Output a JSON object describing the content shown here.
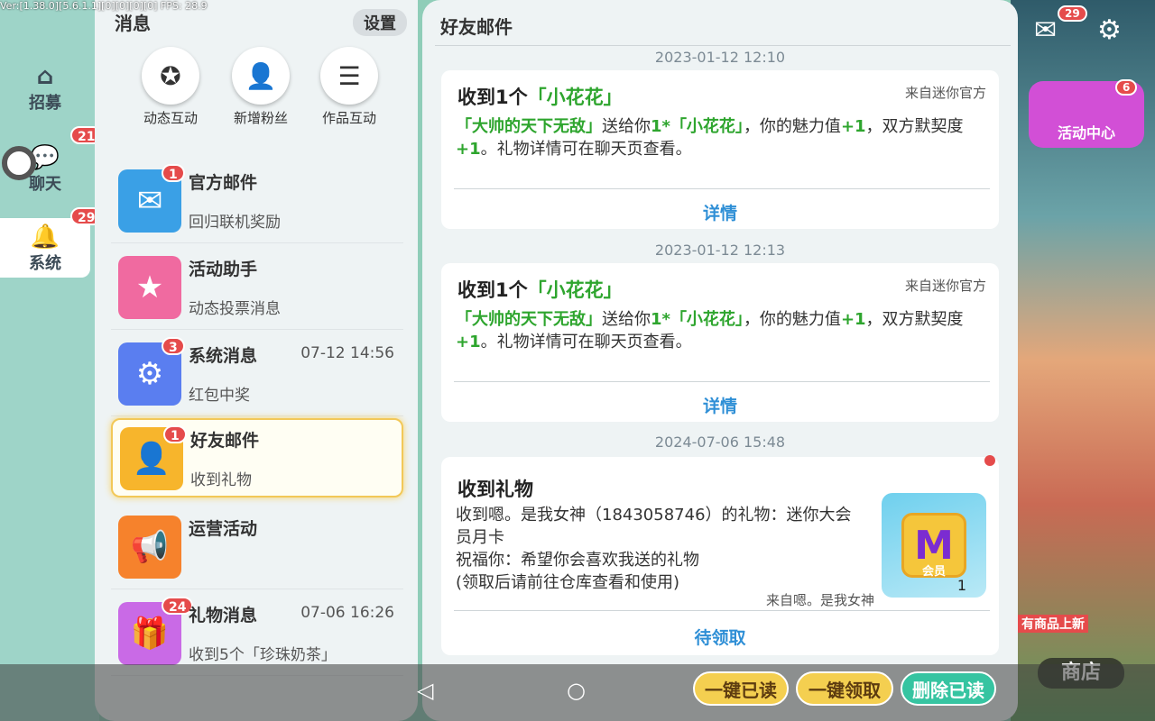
{
  "version_text": "Ver:[1.38.0][5.6.1.1][0][0][0][0] FPS: 28.9",
  "left_tabs": [
    {
      "label": "招募",
      "icon": "home-icon"
    },
    {
      "label": "聊天",
      "icon": "chat-icon",
      "badge": "21"
    },
    {
      "label": "系统",
      "icon": "bell-icon",
      "badge": "29"
    }
  ],
  "list": {
    "title": "消息",
    "settings": "设置",
    "quick": [
      {
        "label": "动态互动",
        "icon": "star-bubble-icon"
      },
      {
        "label": "新增粉丝",
        "icon": "new-fan-icon"
      },
      {
        "label": "作品互动",
        "icon": "list-icon"
      }
    ],
    "items": [
      {
        "name": "官方邮件",
        "sub": "回归联机奖励",
        "badge": "1",
        "time": "",
        "color": "#3aa0e6"
      },
      {
        "name": "活动助手",
        "sub": "动态投票消息",
        "badge": "",
        "time": "",
        "color": "#f06aa0"
      },
      {
        "name": "系统消息",
        "sub": "红包中奖",
        "badge": "3",
        "time": "07-12 14:56",
        "color": "#5a7ef0"
      },
      {
        "name": "好友邮件",
        "sub": "收到礼物",
        "badge": "1",
        "time": "",
        "color": "#f7b52c"
      },
      {
        "name": "运营活动",
        "sub": "",
        "badge": "",
        "time": "",
        "color": "#f6822c"
      },
      {
        "name": "礼物消息",
        "sub": "收到5个「珍珠奶茶」",
        "badge": "24",
        "time": "07-06 16:26",
        "color": "#c96ae6"
      }
    ]
  },
  "mail": {
    "title": "好友邮件",
    "cards": [
      {
        "date": "2023-01-12 12:10",
        "title_pre": "收到1个",
        "title_item": "「小花花」",
        "from": "来自迷你官方",
        "sender": "「大帅的天下无敌」",
        "t1": "送给你",
        "g1": "1*「小花花」",
        "t2": "，你的魅力值",
        "g2": "+1",
        "t3": "，双方默契度",
        "g3": "+1",
        "t4": "。礼物详情可在聊天页查看。",
        "action": "详情"
      },
      {
        "date": "2023-01-12 12:13",
        "title_pre": "收到1个",
        "title_item": "「小花花」",
        "from": "来自迷你官方",
        "sender": "「大帅的天下无敌」",
        "t1": "送给你",
        "g1": "1*「小花花」",
        "t2": "，你的魅力值",
        "g2": "+1",
        "t3": "，双方默契度",
        "g3": "+1",
        "t4": "。礼物详情可在聊天页查看。",
        "action": "详情"
      }
    ],
    "gift_card": {
      "date": "2024-07-06 15:48",
      "title": "收到礼物",
      "line1": "收到嗯。是我女神（1843058746）的礼物：迷你大会员月卡",
      "line2": "祝福你：希望你会喜欢我送的礼物",
      "line3": "(领取后请前往仓库查看和使用)",
      "from": "来自嗯。是我女神",
      "image_label": "会员",
      "image_count": "1",
      "action": "待领取"
    }
  },
  "buttons": {
    "read_all": "一键已读",
    "claim_all": "一键领取",
    "delete_read": "删除已读"
  },
  "right": {
    "mail_badge": "29",
    "event_badge": "6",
    "event_label": "活动中心",
    "new_goods": "有商品上新",
    "shop": "商店"
  }
}
